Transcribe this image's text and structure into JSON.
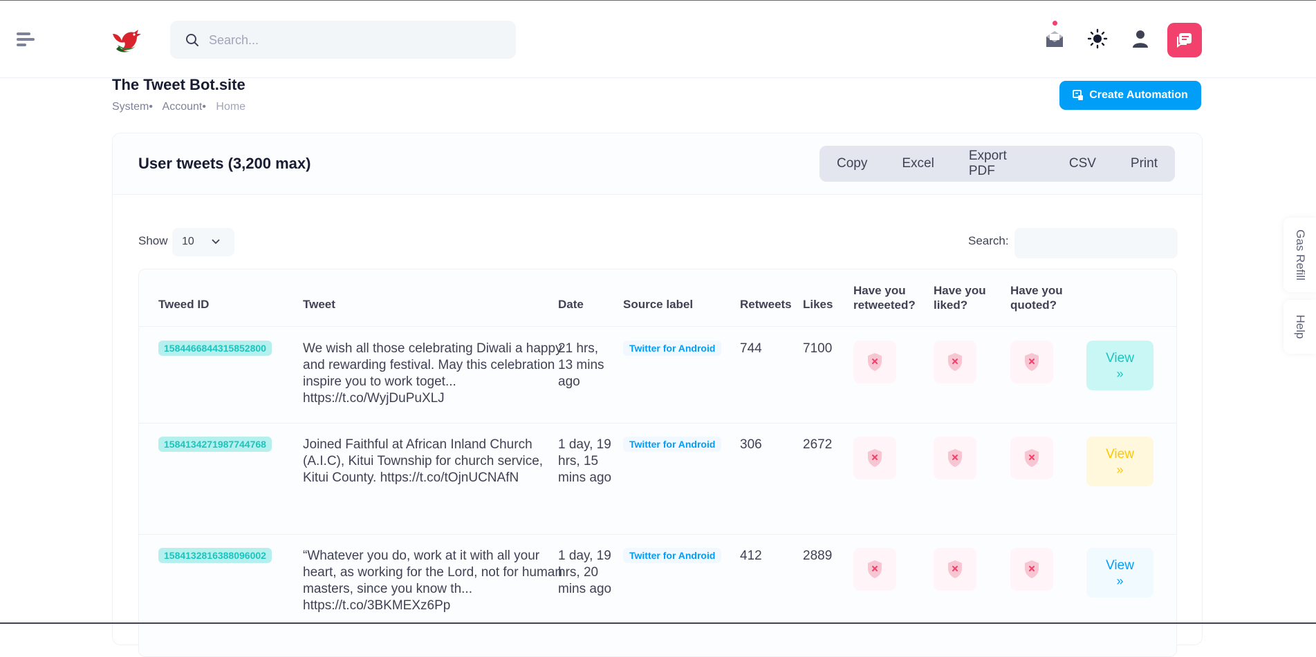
{
  "header": {
    "search_placeholder": "Search...",
    "icons": [
      "menu-icon",
      "bird-logo",
      "search-icon",
      "envelope-icon",
      "sun-icon",
      "user-icon",
      "chat-icon"
    ]
  },
  "page": {
    "title": "The Tweet Bot.site",
    "breadcrumb": [
      "System•",
      "Account•",
      "Home"
    ],
    "create_button": "Create Automation"
  },
  "card": {
    "title": "User tweets (3,200 max)",
    "export_buttons": [
      "Copy",
      "Excel",
      "Export PDF",
      "CSV",
      "Print"
    ],
    "show_label": "Show",
    "page_length": "10",
    "search_label": "Search:"
  },
  "table": {
    "columns": [
      "Tweed ID",
      "Tweet",
      "Date",
      "Source label",
      "Retweets",
      "Likes",
      "Have you retweeted?",
      "Have you liked?",
      "Have you quoted?"
    ],
    "view_label": "View",
    "rows": [
      {
        "id": "1584466844315852800",
        "tweet": "We wish all those celebrating Diwali a happy and rewarding festival. May this celebration inspire you to work toget... https://t.co/WyjDuPuXLJ",
        "date": "21 hrs, 13 mins ago",
        "source": "Twitter for Android",
        "retweets": "744",
        "likes": "7100"
      },
      {
        "id": "1584134271987744768",
        "tweet": "Joined Faithful at African Inland Church (A.I.C), Kitui Township for church service, Kitui County. https://t.co/tOjnUCNAfN",
        "date": "1 day, 19 hrs, 15 mins ago",
        "source": "Twitter for Android",
        "retweets": "306",
        "likes": "2672"
      },
      {
        "id": "1584132816388096002",
        "tweet": "“Whatever you do, work at it with all your heart, as working for the Lord, not for human masters, since you know th... https://t.co/3BKMEXz6Pp",
        "date": "1 day, 19 hrs, 20 mins ago",
        "source": "Twitter for Android",
        "retweets": "412",
        "likes": "2889"
      }
    ]
  },
  "side_tabs": [
    "Gas Refill",
    "Help"
  ],
  "colors": {
    "primary": "#009ef7",
    "danger": "#f1416c",
    "teal": "#1bc5bd",
    "warning": "#ffc700"
  }
}
